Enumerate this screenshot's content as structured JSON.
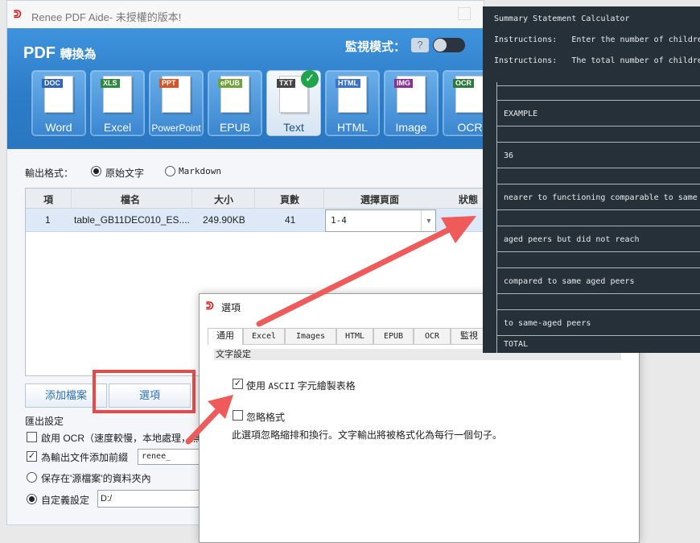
{
  "app": {
    "title": "Renee PDF Aide- 未授權的版本!",
    "logo_glyph": "ᕲ"
  },
  "header": {
    "convert_prefix": "PDF",
    "convert_label": "轉換為",
    "monitor_label": "監視模式：",
    "monitor_help_glyph": "?",
    "monitor_on": false
  },
  "formats": [
    {
      "tag": "DOC",
      "label": "Word",
      "tag_color": "#2f64b6"
    },
    {
      "tag": "XLS",
      "label": "Excel",
      "tag_color": "#2e8b3e"
    },
    {
      "tag": "PPT",
      "label": "PowerPoint",
      "tag_color": "#d2562a"
    },
    {
      "tag": "ePUB",
      "label": "EPUB",
      "tag_color": "#6fa33a"
    },
    {
      "tag": "TXT",
      "label": "Text",
      "tag_color": "#444444",
      "selected": true
    },
    {
      "tag": "HTML",
      "label": "HTML",
      "tag_color": "#3b73c6"
    },
    {
      "tag": "IMG",
      "label": "Image",
      "tag_color": "#8a2f9a"
    },
    {
      "tag": "OCR",
      "label": "OCR",
      "tag_color": "#2d7a3a"
    }
  ],
  "output_format": {
    "label": "輸出格式：",
    "options": [
      "原始文字",
      "Markdown"
    ],
    "selected": "原始文字"
  },
  "table": {
    "columns": [
      "項",
      "檔名",
      "大小",
      "頁數",
      "選擇頁面",
      "狀態"
    ],
    "rows": [
      {
        "index": "1",
        "filename": "table_GB11DEC010_ES....",
        "size": "249.90KB",
        "pages": "41",
        "page_range": "1-4"
      }
    ]
  },
  "buttons": {
    "add_file": "添加檔案",
    "options": "選項"
  },
  "output_settings": {
    "label": "匯出設定",
    "ocr_label": "啟用 OCR（速度較慢，本地處理，無",
    "ocr_checked": false,
    "prefix_label": "為輸出文件添加前綴",
    "prefix_checked": true,
    "prefix_value": "renee_",
    "save_source_label": "保存在'源檔案'的資料夾內",
    "custom_label": "自定義設定",
    "custom_path": "D:/",
    "selected": "custom"
  },
  "dialog": {
    "title": "選項",
    "tabs": [
      "通用",
      "Excel",
      "Images",
      "HTML",
      "EPUB",
      "OCR",
      "監視"
    ],
    "active_tab": "通用",
    "section": "文字設定",
    "ascii_label_prefix": "使用 ",
    "ascii_label_mono": "ASCII",
    "ascii_label_suffix": " 字元繪製表格",
    "ascii_checked": true,
    "ignore_label": "忽略格式",
    "ignore_checked": false,
    "ignore_desc": "此選項忽略縮排和換行。文字輸出將被格式化為每行一個句子。"
  },
  "console": {
    "title": "Summary Statement Calculator",
    "instructions_1": "Instructions:   Enter the number of childre",
    "instructions_2": "Instructions:   The total number of childre",
    "rows": [
      "EXAMPLE",
      "36",
      "nearer to functioning comparable to same",
      "aged peers but did not reach",
      "compared to same aged peers",
      "to same-aged peers",
      "TOTAL"
    ]
  },
  "colors": {
    "highlight": "#e84a4a",
    "accent": "#2d7cc8"
  }
}
